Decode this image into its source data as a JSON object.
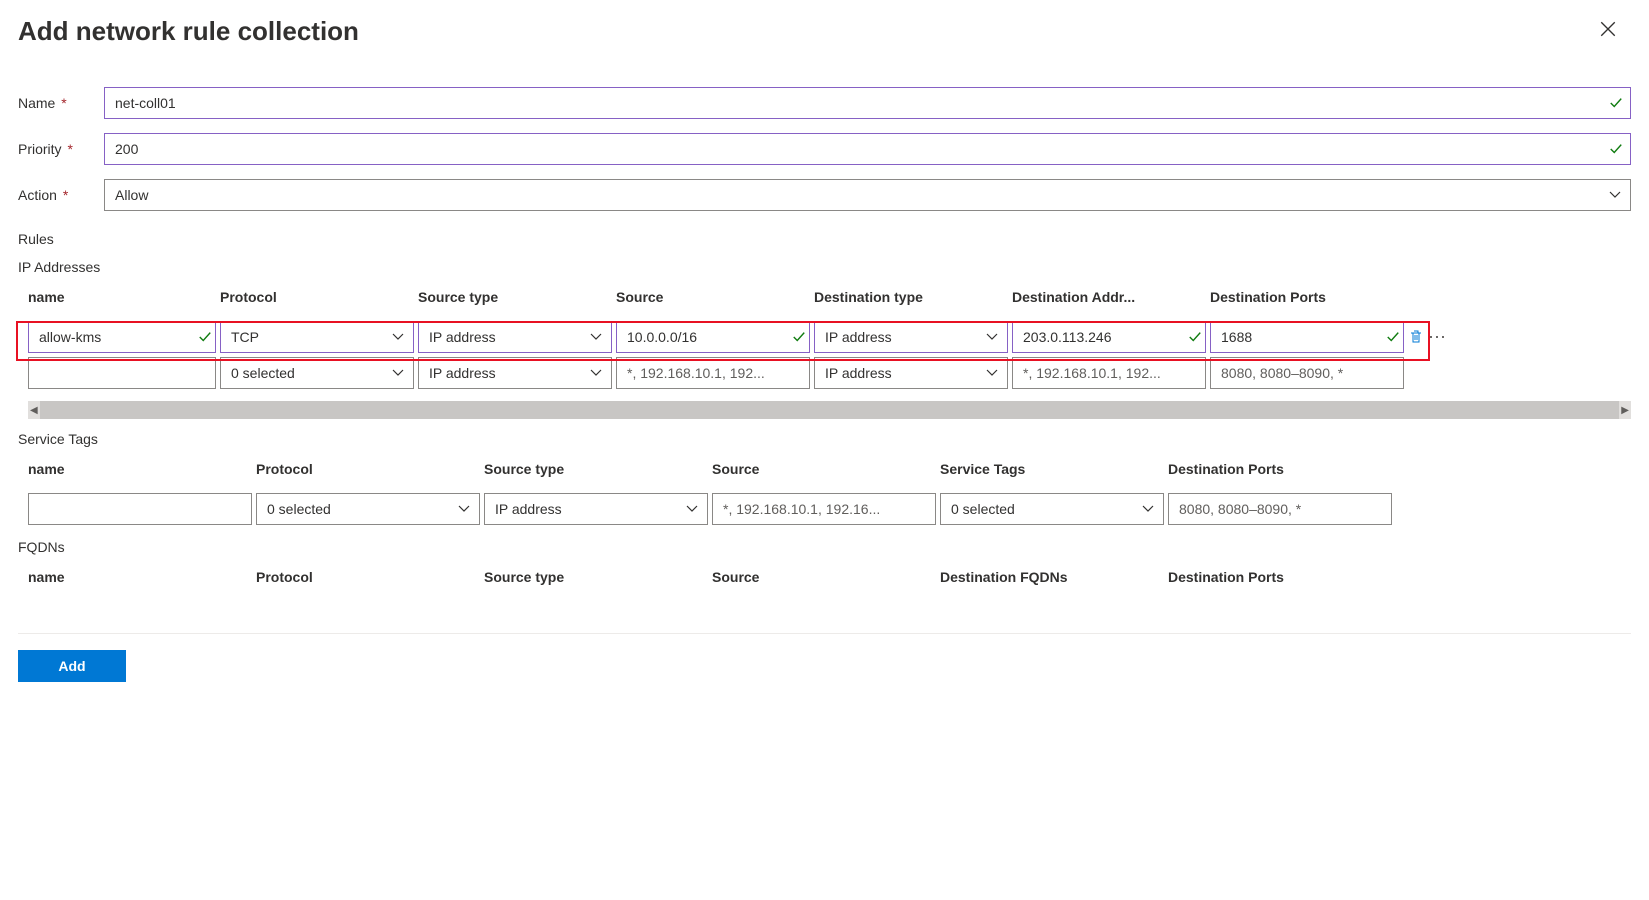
{
  "title": "Add network rule collection",
  "form": {
    "name_label": "Name",
    "name_value": "net-coll01",
    "priority_label": "Priority",
    "priority_value": "200",
    "action_label": "Action",
    "action_value": "Allow"
  },
  "rules_label": "Rules",
  "ip_section": {
    "label": "IP Addresses",
    "headers": {
      "name": "name",
      "protocol": "Protocol",
      "source_type": "Source type",
      "source": "Source",
      "dest_type": "Destination type",
      "dest_addr": "Destination Addr...",
      "dest_ports": "Destination Ports"
    },
    "rows": [
      {
        "name": "allow-kms",
        "protocol": "TCP",
        "source_type": "IP address",
        "source": "10.0.0.0/16",
        "dest_type": "IP address",
        "dest_addr": "203.0.113.246",
        "dest_ports": "1688"
      },
      {
        "name": "",
        "protocol": "0 selected",
        "source_type": "IP address",
        "source_ph": "*, 192.168.10.1, 192...",
        "dest_type": "IP address",
        "dest_addr_ph": "*, 192.168.10.1, 192...",
        "dest_ports_ph": "8080, 8080–8090, *"
      }
    ]
  },
  "svc_section": {
    "label": "Service Tags",
    "headers": {
      "name": "name",
      "protocol": "Protocol",
      "source_type": "Source type",
      "source": "Source",
      "service_tags": "Service Tags",
      "dest_ports": "Destination Ports"
    },
    "row": {
      "name": "",
      "protocol": "0 selected",
      "source_type": "IP address",
      "source_ph": "*, 192.168.10.1, 192.16...",
      "service_tags": "0 selected",
      "dest_ports_ph": "8080, 8080–8090, *"
    }
  },
  "fqdn_section": {
    "label": "FQDNs",
    "headers": {
      "name": "name",
      "protocol": "Protocol",
      "source_type": "Source type",
      "source": "Source",
      "dest_fqdns": "Destination FQDNs",
      "dest_ports": "Destination Ports"
    }
  },
  "footer": {
    "add_label": "Add"
  }
}
